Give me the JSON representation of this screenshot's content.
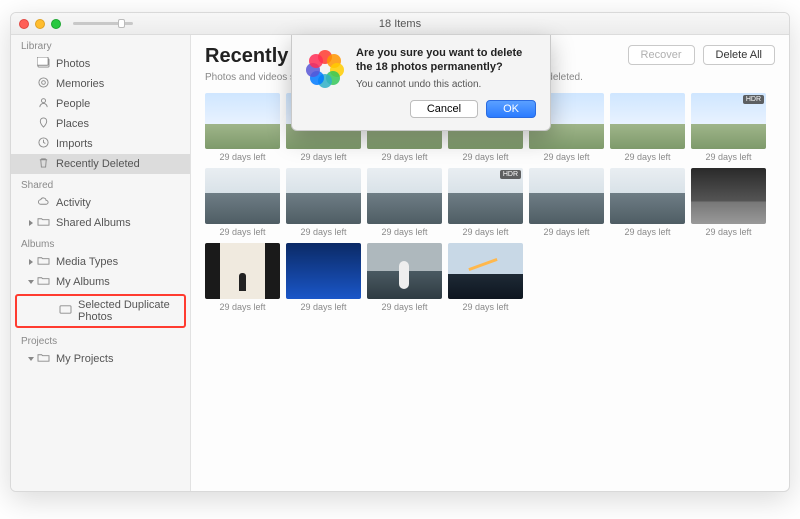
{
  "titlebar": {
    "title": "18 Items"
  },
  "sidebar": {
    "groups": [
      {
        "header": "Library",
        "items": [
          {
            "icon": "photos-icon",
            "label": "Photos"
          },
          {
            "icon": "memories-icon",
            "label": "Memories"
          },
          {
            "icon": "people-icon",
            "label": "People"
          },
          {
            "icon": "places-icon",
            "label": "Places"
          },
          {
            "icon": "imports-icon",
            "label": "Imports"
          },
          {
            "icon": "trash-icon",
            "label": "Recently Deleted",
            "selected": true
          }
        ]
      },
      {
        "header": "Shared",
        "items": [
          {
            "icon": "cloud-icon",
            "label": "Activity"
          },
          {
            "icon": "folder-icon",
            "label": "Shared Albums",
            "disclosure": "col"
          }
        ]
      },
      {
        "header": "Albums",
        "items": [
          {
            "icon": "folder-icon",
            "label": "Media Types",
            "disclosure": "col"
          },
          {
            "icon": "folder-icon",
            "label": "My Albums",
            "disclosure": "exp"
          },
          {
            "icon": "album-icon",
            "label": "Selected Duplicate Photos",
            "indent": true,
            "highlight": true
          }
        ]
      },
      {
        "header": "Projects",
        "items": [
          {
            "icon": "folder-icon",
            "label": "My Projects",
            "disclosure": "exp"
          }
        ]
      }
    ]
  },
  "main": {
    "title": "Recently D",
    "subtitle_prefix": "Photos and videos show",
    "subtitle_suffix": "ntly deleted.",
    "recover_label": "Recover",
    "delete_all_label": "Delete All",
    "caption": "29 days left",
    "hdr_badge": "HDR",
    "thumbs": [
      {
        "cls": "sky"
      },
      {
        "cls": "sky"
      },
      {
        "cls": "sky"
      },
      {
        "cls": "sky"
      },
      {
        "cls": "sky"
      },
      {
        "cls": "sky"
      },
      {
        "cls": "sky",
        "badge": true
      },
      {
        "cls": "sea"
      },
      {
        "cls": "sea"
      },
      {
        "cls": "sea"
      },
      {
        "cls": "sea",
        "badge": true
      },
      {
        "cls": "sea"
      },
      {
        "cls": "sea"
      },
      {
        "cls": "dark"
      },
      {
        "cls": "hall"
      },
      {
        "cls": "blue"
      },
      {
        "cls": "surf"
      },
      {
        "cls": "orange"
      }
    ]
  },
  "dialog": {
    "headline": "Are you sure you want to delete the 18 photos permanently?",
    "detail": "You cannot undo this action.",
    "cancel": "Cancel",
    "ok": "OK"
  }
}
